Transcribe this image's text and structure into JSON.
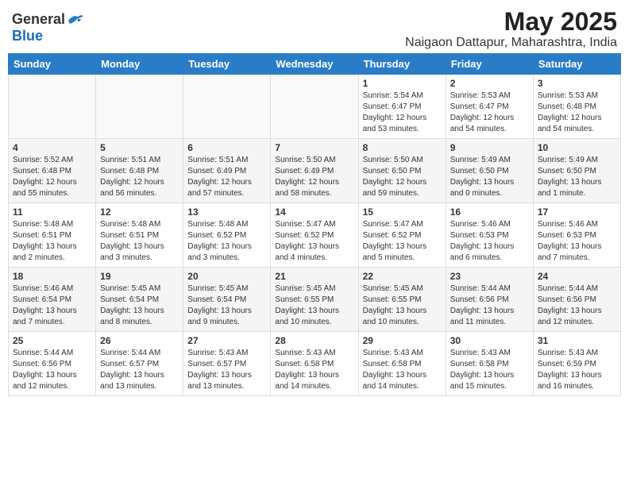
{
  "header": {
    "logo_general": "General",
    "logo_blue": "Blue",
    "main_title": "May 2025",
    "subtitle": "Naigaon Dattapur, Maharashtra, India"
  },
  "weekdays": [
    "Sunday",
    "Monday",
    "Tuesday",
    "Wednesday",
    "Thursday",
    "Friday",
    "Saturday"
  ],
  "rows": [
    [
      {
        "day": "",
        "info": ""
      },
      {
        "day": "",
        "info": ""
      },
      {
        "day": "",
        "info": ""
      },
      {
        "day": "",
        "info": ""
      },
      {
        "day": "1",
        "info": "Sunrise: 5:54 AM\nSunset: 6:47 PM\nDaylight: 12 hours\nand 53 minutes."
      },
      {
        "day": "2",
        "info": "Sunrise: 5:53 AM\nSunset: 6:47 PM\nDaylight: 12 hours\nand 54 minutes."
      },
      {
        "day": "3",
        "info": "Sunrise: 5:53 AM\nSunset: 6:48 PM\nDaylight: 12 hours\nand 54 minutes."
      }
    ],
    [
      {
        "day": "4",
        "info": "Sunrise: 5:52 AM\nSunset: 6:48 PM\nDaylight: 12 hours\nand 55 minutes."
      },
      {
        "day": "5",
        "info": "Sunrise: 5:51 AM\nSunset: 6:48 PM\nDaylight: 12 hours\nand 56 minutes."
      },
      {
        "day": "6",
        "info": "Sunrise: 5:51 AM\nSunset: 6:49 PM\nDaylight: 12 hours\nand 57 minutes."
      },
      {
        "day": "7",
        "info": "Sunrise: 5:50 AM\nSunset: 6:49 PM\nDaylight: 12 hours\nand 58 minutes."
      },
      {
        "day": "8",
        "info": "Sunrise: 5:50 AM\nSunset: 6:50 PM\nDaylight: 12 hours\nand 59 minutes."
      },
      {
        "day": "9",
        "info": "Sunrise: 5:49 AM\nSunset: 6:50 PM\nDaylight: 13 hours\nand 0 minutes."
      },
      {
        "day": "10",
        "info": "Sunrise: 5:49 AM\nSunset: 6:50 PM\nDaylight: 13 hours\nand 1 minute."
      }
    ],
    [
      {
        "day": "11",
        "info": "Sunrise: 5:48 AM\nSunset: 6:51 PM\nDaylight: 13 hours\nand 2 minutes."
      },
      {
        "day": "12",
        "info": "Sunrise: 5:48 AM\nSunset: 6:51 PM\nDaylight: 13 hours\nand 3 minutes."
      },
      {
        "day": "13",
        "info": "Sunrise: 5:48 AM\nSunset: 6:52 PM\nDaylight: 13 hours\nand 3 minutes."
      },
      {
        "day": "14",
        "info": "Sunrise: 5:47 AM\nSunset: 6:52 PM\nDaylight: 13 hours\nand 4 minutes."
      },
      {
        "day": "15",
        "info": "Sunrise: 5:47 AM\nSunset: 6:52 PM\nDaylight: 13 hours\nand 5 minutes."
      },
      {
        "day": "16",
        "info": "Sunrise: 5:46 AM\nSunset: 6:53 PM\nDaylight: 13 hours\nand 6 minutes."
      },
      {
        "day": "17",
        "info": "Sunrise: 5:46 AM\nSunset: 6:53 PM\nDaylight: 13 hours\nand 7 minutes."
      }
    ],
    [
      {
        "day": "18",
        "info": "Sunrise: 5:46 AM\nSunset: 6:54 PM\nDaylight: 13 hours\nand 7 minutes."
      },
      {
        "day": "19",
        "info": "Sunrise: 5:45 AM\nSunset: 6:54 PM\nDaylight: 13 hours\nand 8 minutes."
      },
      {
        "day": "20",
        "info": "Sunrise: 5:45 AM\nSunset: 6:54 PM\nDaylight: 13 hours\nand 9 minutes."
      },
      {
        "day": "21",
        "info": "Sunrise: 5:45 AM\nSunset: 6:55 PM\nDaylight: 13 hours\nand 10 minutes."
      },
      {
        "day": "22",
        "info": "Sunrise: 5:45 AM\nSunset: 6:55 PM\nDaylight: 13 hours\nand 10 minutes."
      },
      {
        "day": "23",
        "info": "Sunrise: 5:44 AM\nSunset: 6:56 PM\nDaylight: 13 hours\nand 11 minutes."
      },
      {
        "day": "24",
        "info": "Sunrise: 5:44 AM\nSunset: 6:56 PM\nDaylight: 13 hours\nand 12 minutes."
      }
    ],
    [
      {
        "day": "25",
        "info": "Sunrise: 5:44 AM\nSunset: 6:56 PM\nDaylight: 13 hours\nand 12 minutes."
      },
      {
        "day": "26",
        "info": "Sunrise: 5:44 AM\nSunset: 6:57 PM\nDaylight: 13 hours\nand 13 minutes."
      },
      {
        "day": "27",
        "info": "Sunrise: 5:43 AM\nSunset: 6:57 PM\nDaylight: 13 hours\nand 13 minutes."
      },
      {
        "day": "28",
        "info": "Sunrise: 5:43 AM\nSunset: 6:58 PM\nDaylight: 13 hours\nand 14 minutes."
      },
      {
        "day": "29",
        "info": "Sunrise: 5:43 AM\nSunset: 6:58 PM\nDaylight: 13 hours\nand 14 minutes."
      },
      {
        "day": "30",
        "info": "Sunrise: 5:43 AM\nSunset: 6:58 PM\nDaylight: 13 hours\nand 15 minutes."
      },
      {
        "day": "31",
        "info": "Sunrise: 5:43 AM\nSunset: 6:59 PM\nDaylight: 13 hours\nand 16 minutes."
      }
    ]
  ]
}
